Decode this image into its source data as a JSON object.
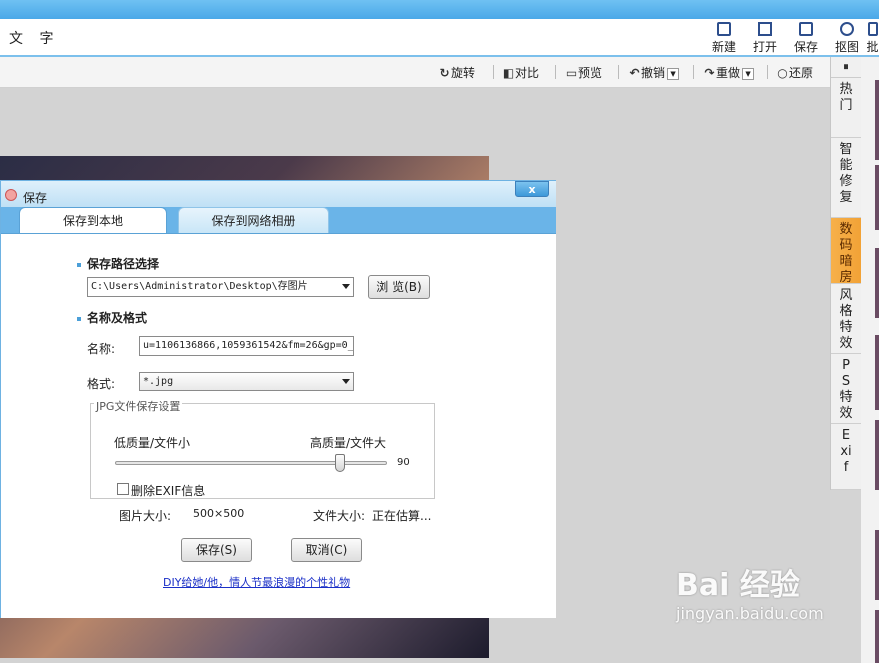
{
  "menubar": {
    "text": "文 字"
  },
  "top_buttons": [
    {
      "label": "新建",
      "icon": "new-file-icon"
    },
    {
      "label": "打开",
      "icon": "folder-icon"
    },
    {
      "label": "保存",
      "icon": "save-icon"
    },
    {
      "label": "抠图",
      "icon": "cutout-icon"
    },
    {
      "label": "批",
      "icon": "batch-icon"
    }
  ],
  "toolbar": {
    "rotate": "旋转",
    "compare": "对比",
    "preview": "预览",
    "undo": "撤销",
    "redo": "重做",
    "restore": "还原"
  },
  "right_panel": {
    "toggle": "⏸",
    "tabs": [
      "热门",
      "智能修复",
      "数码暗房",
      "风格特效",
      "PS特效",
      "Exif"
    ],
    "active_tab": "数码暗房"
  },
  "dialog": {
    "title": "保存",
    "close_label": "x",
    "tabs": [
      "保存到本地",
      "保存到网络相册"
    ],
    "path_section": "保存路径选择",
    "path_value": "C:\\Users\\Administrator\\Desktop\\存图片",
    "browse_label": "浏 览(B)",
    "name_section": "名称及格式",
    "name_label": "名称:",
    "name_value": "u=1106136866,1059361542&fm=26&gp=0_",
    "format_label": "格式:",
    "format_value": "*.jpg",
    "jpg_group_title": "JPG文件保存设置",
    "quality_low": "低质量/文件小",
    "quality_high": "高质量/文件大",
    "quality_value": 90,
    "quality_value_text": "90",
    "remove_exif": "删除EXIF信息",
    "image_size_label": "图片大小:",
    "image_size_value": "500×500",
    "file_size_label": "文件大小:",
    "file_size_value": "正在估算...",
    "save_label": "保存(S)",
    "cancel_label": "取消(C)",
    "promo_link": "DIY给她/他，情人节最浪漫的个性礼物"
  },
  "watermark": {
    "main": "Bai 经验",
    "sub": "jingyan.baidu.com"
  }
}
